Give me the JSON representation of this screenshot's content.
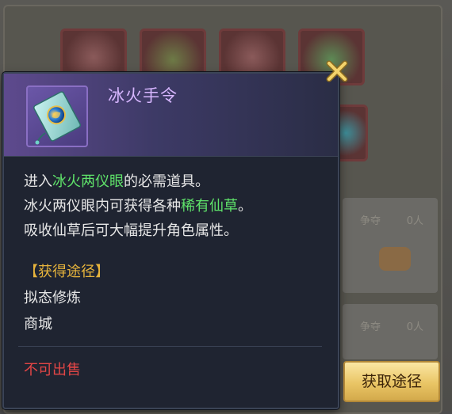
{
  "background": {
    "cards": [
      {
        "label": "争夺",
        "count": "0人"
      },
      {
        "label": "争夺",
        "count": "0人"
      }
    ]
  },
  "tooltip": {
    "item_name": "冰火手令",
    "icon": "token-icon",
    "description": {
      "line1_pre": "进入",
      "line1_hl": "冰火两仪眼",
      "line1_post": "的必需道具。",
      "line2_pre": "冰火两仪眼内可获得各种",
      "line2_hl": "稀有仙草",
      "line2_post": "。",
      "line3": "吸收仙草后可大幅提升角色属性。"
    },
    "source_title": "【获得途径】",
    "sources": [
      "拟态修炼",
      "商城"
    ],
    "not_sellable": "不可出售",
    "close_icon": "close-icon"
  },
  "obtain_button": {
    "label": "获取途径"
  },
  "colors": {
    "highlight_green": "#5fe36a",
    "title_purple": "#d7b6ff",
    "section_gold": "#e7b43c",
    "warning_red": "#e34646",
    "button_gold": "#e9c565"
  }
}
